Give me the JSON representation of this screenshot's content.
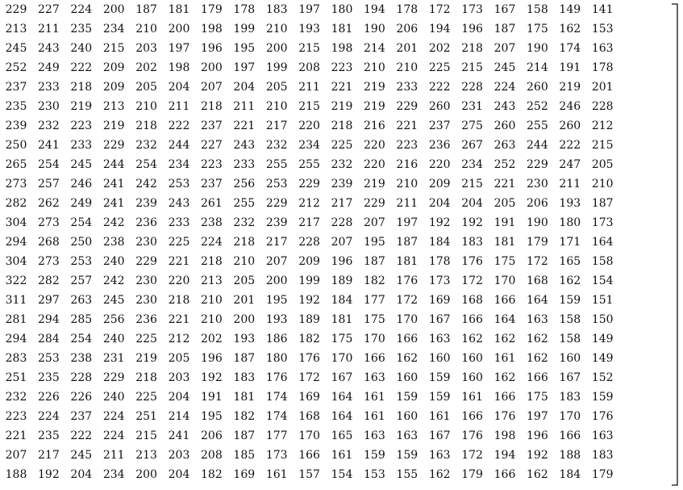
{
  "matrix": {
    "rows": [
      [
        "229",
        "227",
        "224",
        "200",
        "187",
        "181",
        "179",
        "178",
        "183",
        "197",
        "180",
        "194",
        "178",
        "172",
        "173",
        "167",
        "158",
        "149",
        "141"
      ],
      [
        "213",
        "211",
        "235",
        "234",
        "210",
        "200",
        "198",
        "199",
        "210",
        "193",
        "181",
        "190",
        "206",
        "194",
        "196",
        "187",
        "175",
        "162",
        "153"
      ],
      [
        "245",
        "243",
        "240",
        "215",
        "203",
        "197",
        "196",
        "195",
        "200",
        "215",
        "198",
        "214",
        "201",
        "202",
        "218",
        "207",
        "190",
        "174",
        "163"
      ],
      [
        "252",
        "249",
        "222",
        "209",
        "202",
        "198",
        "200",
        "197",
        "199",
        "208",
        "223",
        "210",
        "210",
        "225",
        "215",
        "245",
        "214",
        "191",
        "178"
      ],
      [
        "237",
        "233",
        "218",
        "209",
        "205",
        "204",
        "207",
        "204",
        "205",
        "211",
        "221",
        "219",
        "233",
        "222",
        "228",
        "224",
        "260",
        "219",
        "201"
      ],
      [
        "235",
        "230",
        "219",
        "213",
        "210",
        "211",
        "218",
        "211",
        "210",
        "215",
        "219",
        "219",
        "229",
        "260",
        "231",
        "243",
        "252",
        "246",
        "228"
      ],
      [
        "239",
        "232",
        "223",
        "219",
        "218",
        "222",
        "237",
        "221",
        "217",
        "220",
        "218",
        "216",
        "221",
        "237",
        "275",
        "260",
        "255",
        "260",
        "212"
      ],
      [
        "250",
        "241",
        "233",
        "229",
        "232",
        "244",
        "227",
        "243",
        "232",
        "234",
        "225",
        "220",
        "223",
        "236",
        "267",
        "263",
        "244",
        "222",
        "215"
      ],
      [
        "265",
        "254",
        "245",
        "244",
        "254",
        "234",
        "223",
        "233",
        "255",
        "255",
        "232",
        "220",
        "216",
        "220",
        "234",
        "252",
        "229",
        "247",
        "205"
      ],
      [
        "273",
        "257",
        "246",
        "241",
        "242",
        "253",
        "237",
        "256",
        "253",
        "229",
        "239",
        "219",
        "210",
        "209",
        "215",
        "221",
        "230",
        "211",
        "210"
      ],
      [
        "282",
        "262",
        "249",
        "241",
        "239",
        "243",
        "261",
        "255",
        "229",
        "212",
        "217",
        "229",
        "211",
        "204",
        "204",
        "205",
        "206",
        "193",
        "187"
      ],
      [
        "304",
        "273",
        "254",
        "242",
        "236",
        "233",
        "238",
        "232",
        "239",
        "217",
        "228",
        "207",
        "197",
        "192",
        "192",
        "191",
        "190",
        "180",
        "173"
      ],
      [
        "294",
        "268",
        "250",
        "238",
        "230",
        "225",
        "224",
        "218",
        "217",
        "228",
        "207",
        "195",
        "187",
        "184",
        "183",
        "181",
        "179",
        "171",
        "164"
      ],
      [
        "304",
        "273",
        "253",
        "240",
        "229",
        "221",
        "218",
        "210",
        "207",
        "209",
        "196",
        "187",
        "181",
        "178",
        "176",
        "175",
        "172",
        "165",
        "158"
      ],
      [
        "322",
        "282",
        "257",
        "242",
        "230",
        "220",
        "213",
        "205",
        "200",
        "199",
        "189",
        "182",
        "176",
        "173",
        "172",
        "170",
        "168",
        "162",
        "154"
      ],
      [
        "311",
        "297",
        "263",
        "245",
        "230",
        "218",
        "210",
        "201",
        "195",
        "192",
        "184",
        "177",
        "172",
        "169",
        "168",
        "166",
        "164",
        "159",
        "151"
      ],
      [
        "281",
        "294",
        "285",
        "256",
        "236",
        "221",
        "210",
        "200",
        "193",
        "189",
        "181",
        "175",
        "170",
        "167",
        "166",
        "164",
        "163",
        "158",
        "150"
      ],
      [
        "294",
        "284",
        "254",
        "240",
        "225",
        "212",
        "202",
        "193",
        "186",
        "182",
        "175",
        "170",
        "166",
        "163",
        "162",
        "162",
        "162",
        "158",
        "149"
      ],
      [
        "283",
        "253",
        "238",
        "231",
        "219",
        "205",
        "196",
        "187",
        "180",
        "176",
        "170",
        "166",
        "162",
        "160",
        "160",
        "161",
        "162",
        "160",
        "149"
      ],
      [
        "251",
        "235",
        "228",
        "229",
        "218",
        "203",
        "192",
        "183",
        "176",
        "172",
        "167",
        "163",
        "160",
        "159",
        "160",
        "162",
        "166",
        "167",
        "152"
      ],
      [
        "232",
        "226",
        "226",
        "240",
        "225",
        "204",
        "191",
        "181",
        "174",
        "169",
        "164",
        "161",
        "159",
        "159",
        "161",
        "166",
        "175",
        "183",
        "159"
      ],
      [
        "223",
        "224",
        "237",
        "224",
        "251",
        "214",
        "195",
        "182",
        "174",
        "168",
        "164",
        "161",
        "160",
        "161",
        "166",
        "176",
        "197",
        "170",
        "176"
      ],
      [
        "221",
        "235",
        "222",
        "224",
        "215",
        "241",
        "206",
        "187",
        "177",
        "170",
        "165",
        "163",
        "163",
        "167",
        "176",
        "198",
        "196",
        "166",
        "163"
      ],
      [
        "207",
        "217",
        "245",
        "211",
        "213",
        "203",
        "208",
        "185",
        "173",
        "166",
        "161",
        "159",
        "159",
        "163",
        "172",
        "194",
        "192",
        "188",
        "183"
      ],
      [
        "188",
        "192",
        "204",
        "234",
        "200",
        "204",
        "182",
        "169",
        "161",
        "157",
        "154",
        "153",
        "155",
        "162",
        "179",
        "166",
        "162",
        "184",
        "179"
      ]
    ]
  }
}
